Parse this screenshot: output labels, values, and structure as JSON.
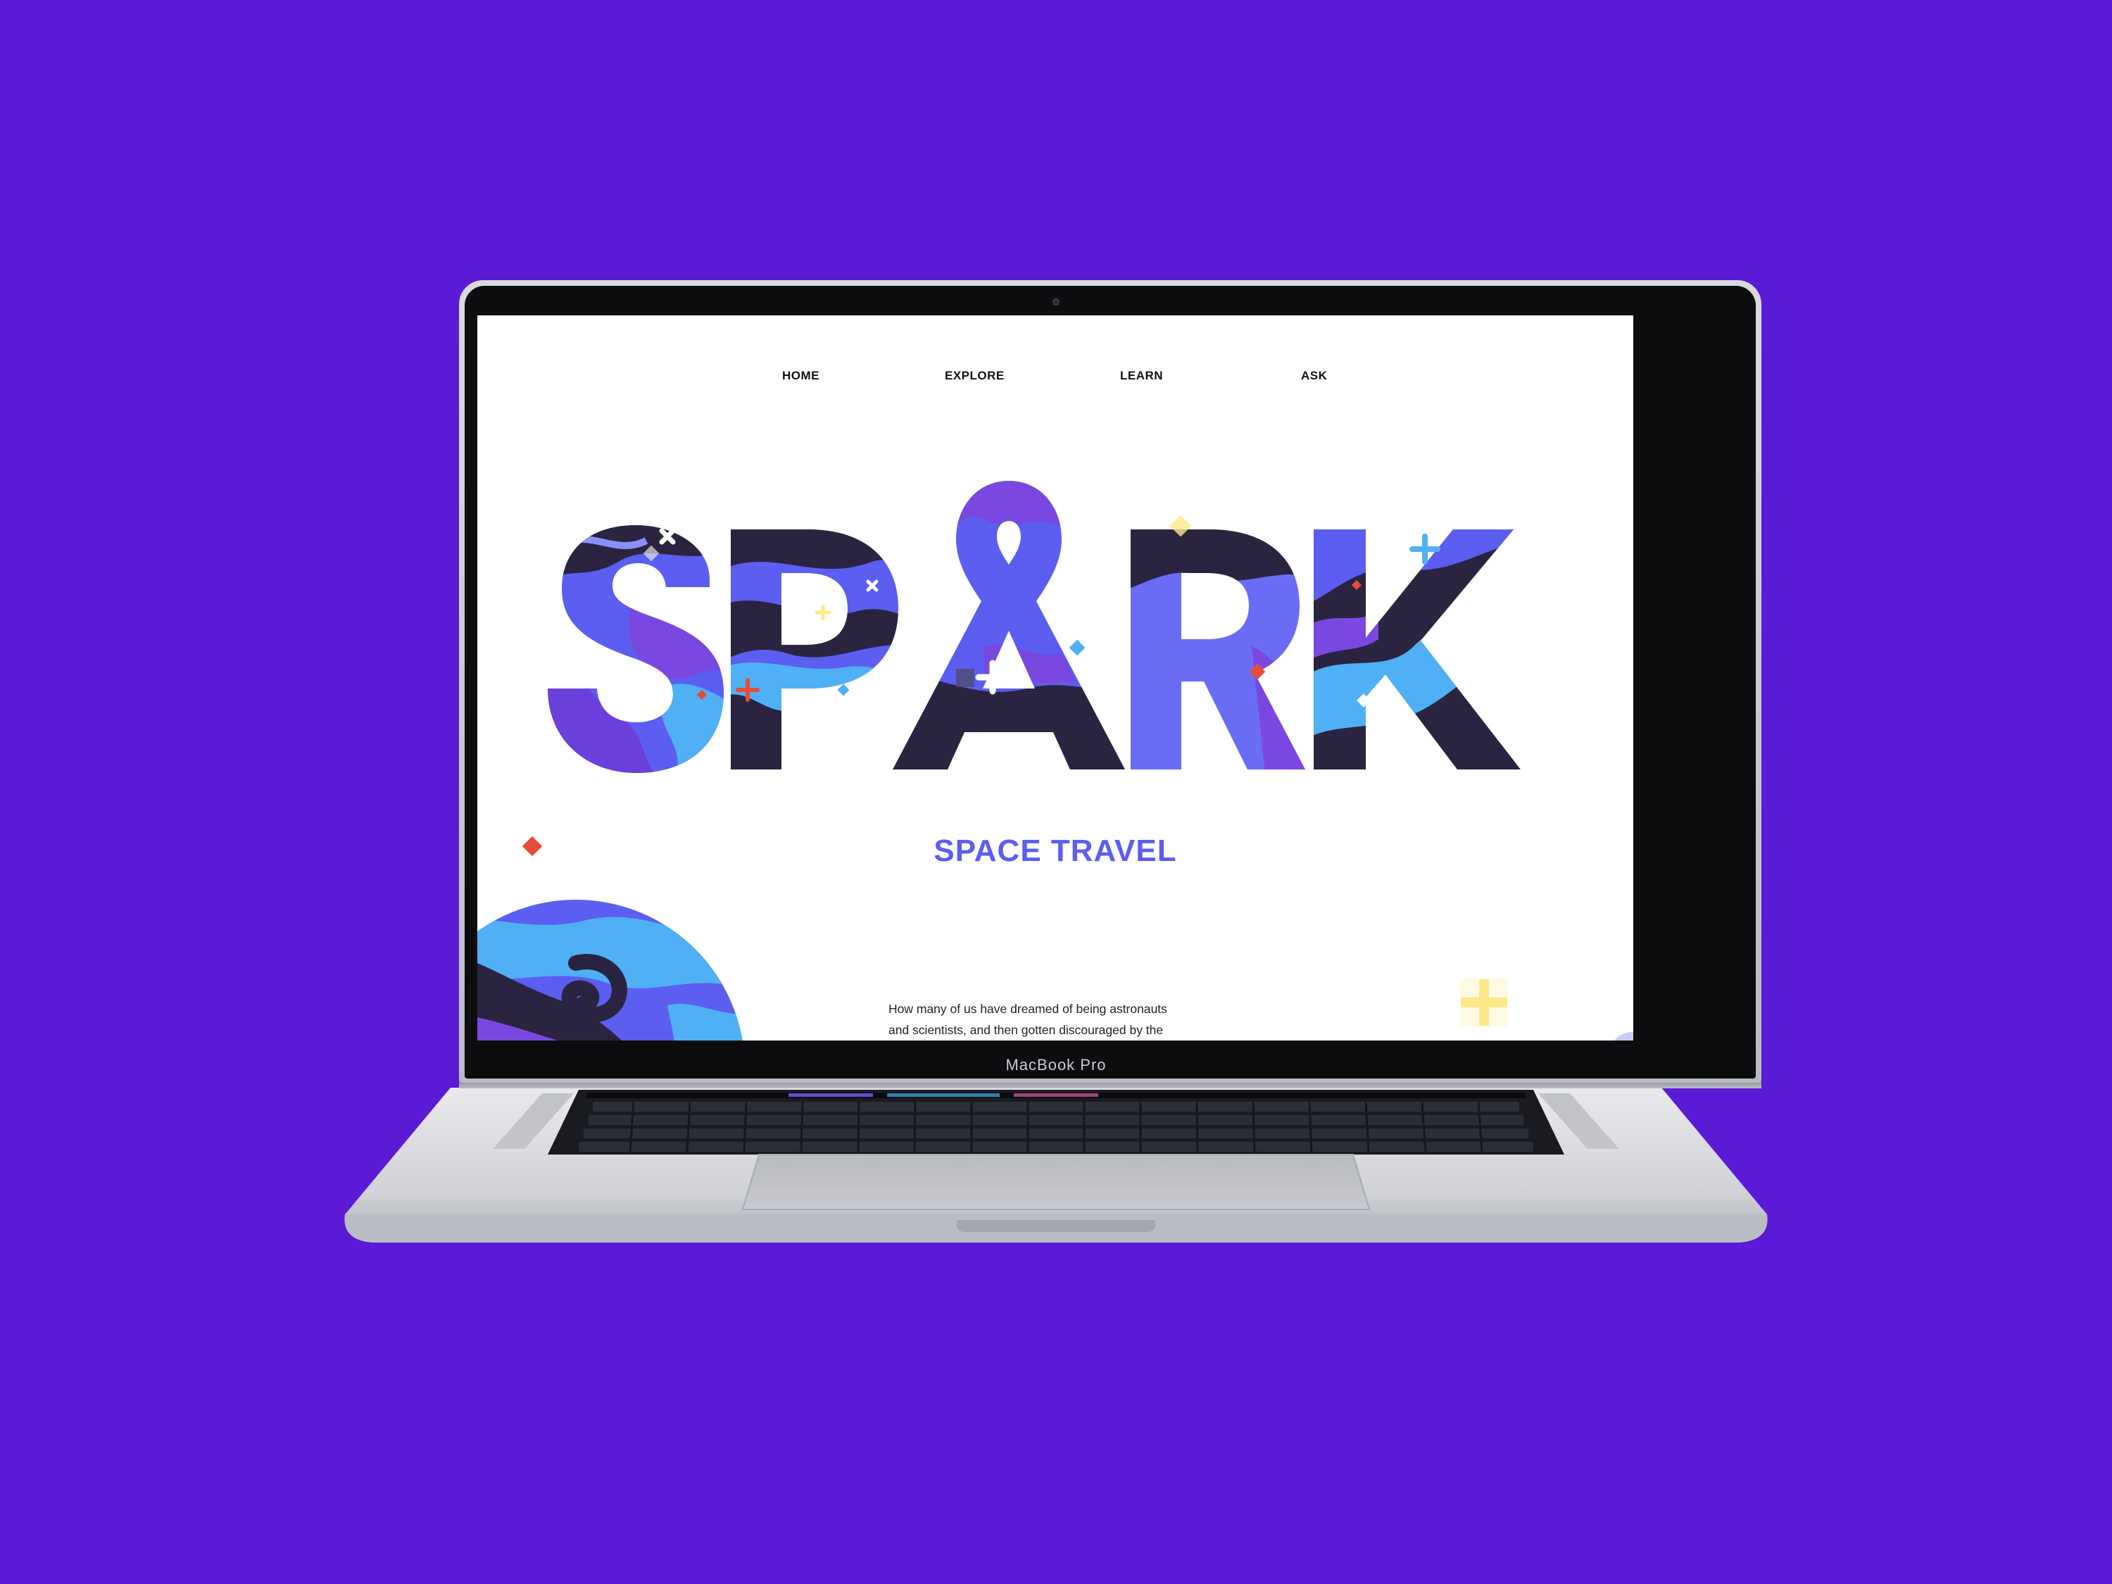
{
  "device": {
    "brand_label": "MacBook Pro"
  },
  "nav": {
    "items": [
      {
        "label": "HOME"
      },
      {
        "label": "EXPLORE"
      },
      {
        "label": "LEARN"
      },
      {
        "label": "ASK"
      }
    ]
  },
  "hero": {
    "title": "SPARK",
    "subtitle": "SPACE TRAVEL",
    "body_line_1": "How many of us have dreamed of being astronauts",
    "body_line_2": "and scientists, and then gotten discouraged by the"
  },
  "colors": {
    "background": "#5a1ad6",
    "accent": "#5b5ef0",
    "dark": "#2a2440",
    "sky": "#4fb0f5",
    "violet": "#7a48e0",
    "red": "#e84b3a",
    "yellow": "#ffe88a"
  }
}
